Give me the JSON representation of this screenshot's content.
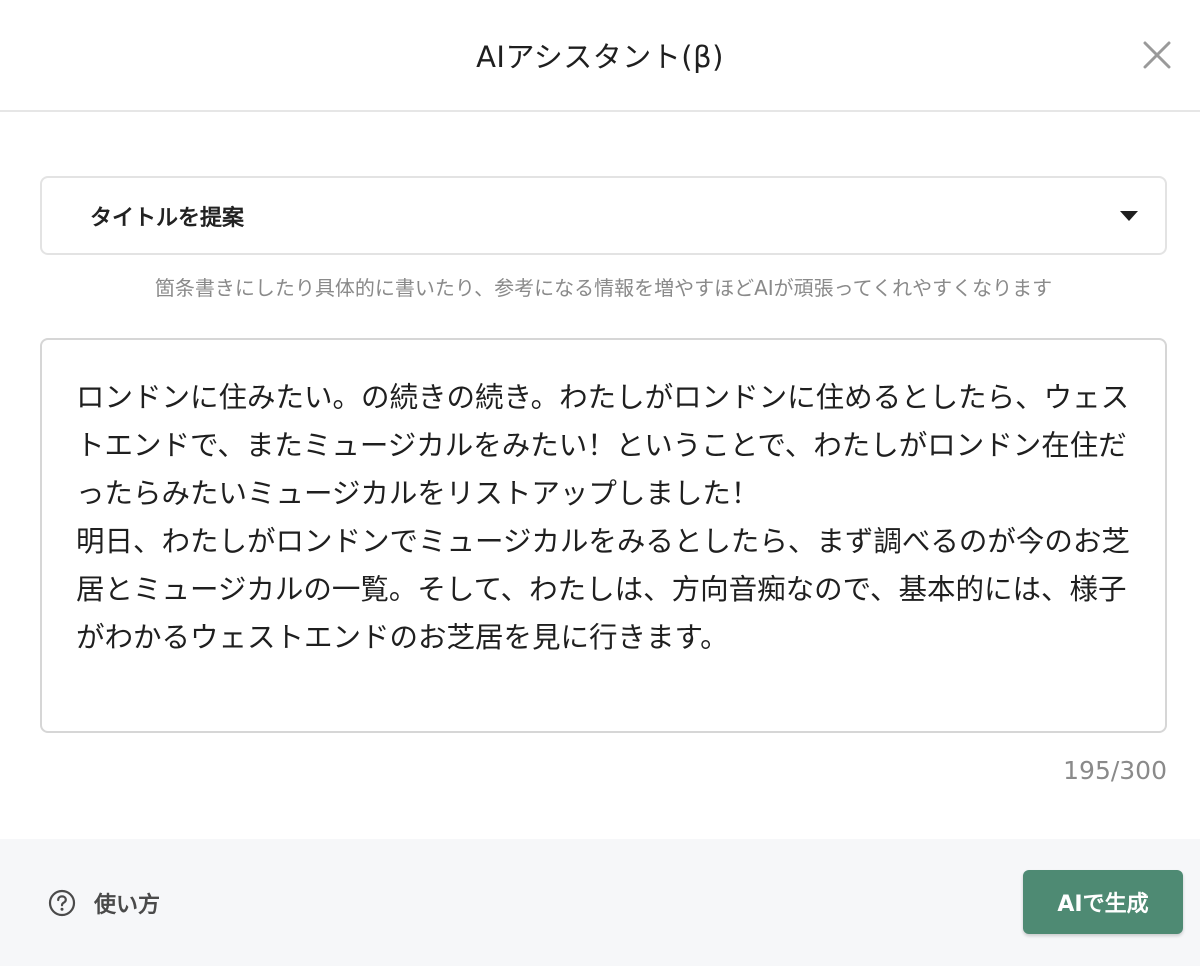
{
  "dialog": {
    "title": "AIアシスタント(β)",
    "close_icon": "close-icon"
  },
  "prompt_select": {
    "selected": "タイトルを提案",
    "caret_icon": "caret-down-icon"
  },
  "hint": "箇条書きにしたり具体的に書いたり、参考になる情報を増やすほどAIが頑張ってくれやすくなります",
  "input": {
    "value": "ロンドンに住みたい。の続きの続き。わたしがロンドンに住めるとしたら、ウェストエンドで、またミュージカルをみたい！ということで、わたしがロンドン在住だったらみたいミュージカルをリストアップしました！\n明日、わたしがロンドンでミュージカルをみるとしたら、まず調べるのが今のお芝居とミュージカルの一覧。そして、わたしは、方向音痴なので、基本的には、様子がわかるウェストエンドのお芝居を見に行きます。",
    "counter": "195/300"
  },
  "footer": {
    "help_label": "使い方",
    "help_icon": "question-circle-icon",
    "generate_label": "AIで生成",
    "accent_color": "#4e8a73"
  }
}
